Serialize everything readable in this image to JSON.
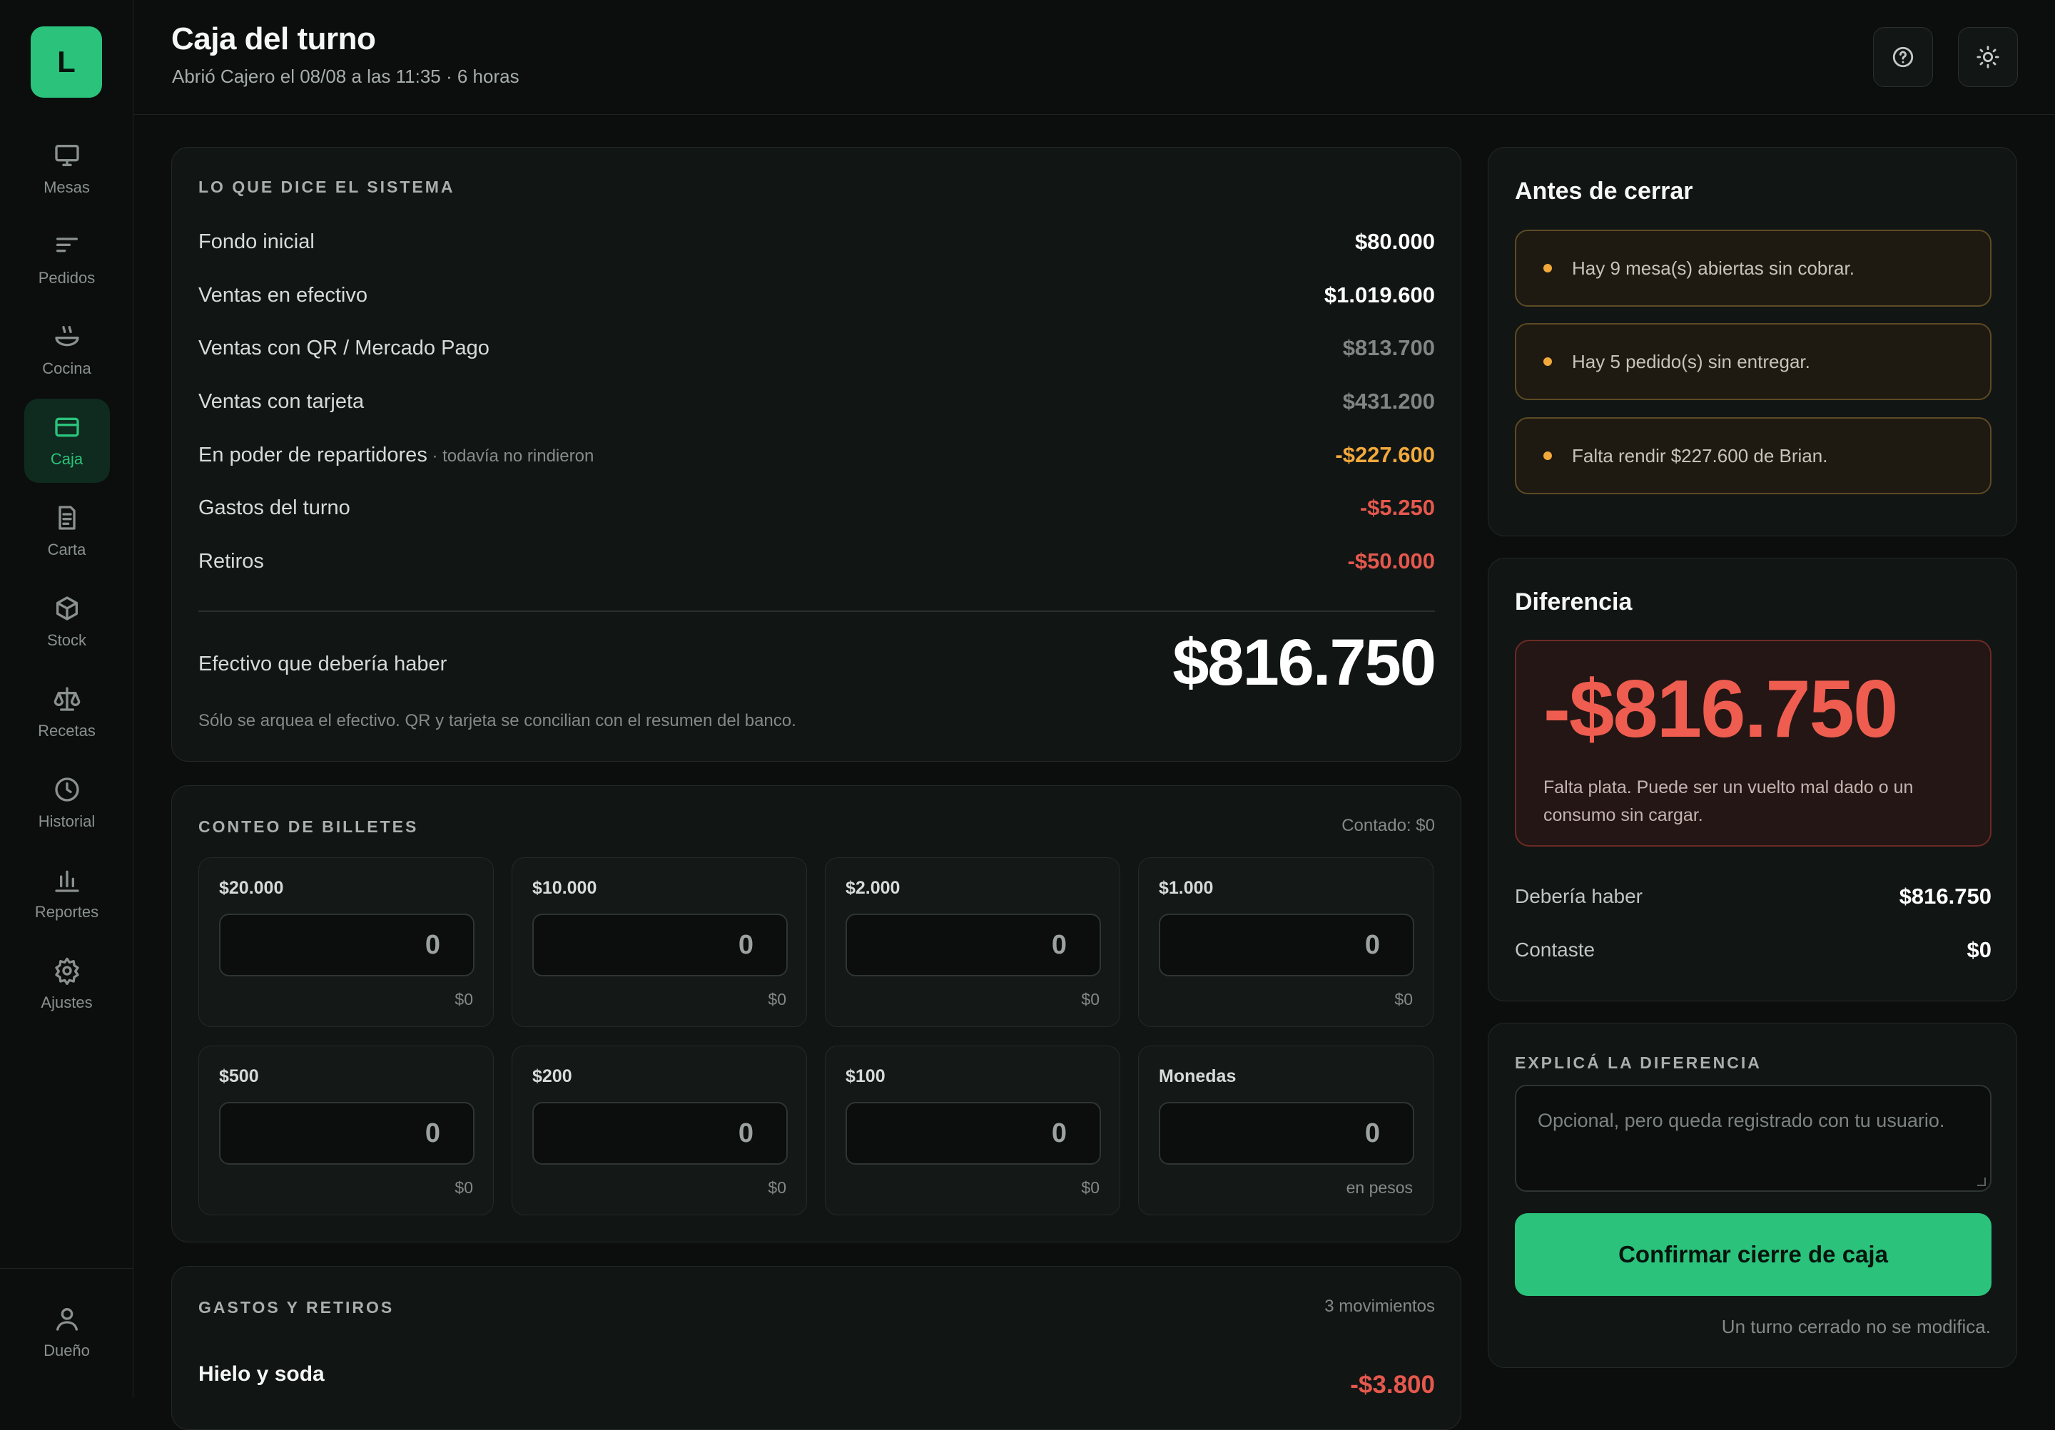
{
  "app": {
    "logo_letter": "L",
    "accent": "#2bc37c"
  },
  "sidebar": {
    "items": [
      {
        "label": "Mesas",
        "icon": "monitor-icon",
        "active": false
      },
      {
        "label": "Pedidos",
        "icon": "list-icon",
        "active": false
      },
      {
        "label": "Cocina",
        "icon": "bowl-icon",
        "active": false
      },
      {
        "label": "Caja",
        "icon": "card-icon",
        "active": true
      },
      {
        "label": "Carta",
        "icon": "document-icon",
        "active": false
      },
      {
        "label": "Stock",
        "icon": "box-icon",
        "active": false
      },
      {
        "label": "Recetas",
        "icon": "scale-icon",
        "active": false
      },
      {
        "label": "Historial",
        "icon": "clock-icon",
        "active": false
      },
      {
        "label": "Reportes",
        "icon": "bar-chart-icon",
        "active": false
      },
      {
        "label": "Ajustes",
        "icon": "gear-icon",
        "active": false
      }
    ],
    "user": {
      "label": "Dueño",
      "icon": "user-icon"
    }
  },
  "header": {
    "title": "Caja del turno",
    "subtitle": "Abrió Cajero el 08/08 a las 11:35 · 6 horas",
    "help_icon": "help-icon",
    "theme_icon": "sun-icon"
  },
  "system": {
    "section_label": "LO QUE DICE EL SISTEMA",
    "rows": [
      {
        "label": "Fondo inicial",
        "note": "",
        "value": "$80.000",
        "tone": "white"
      },
      {
        "label": "Ventas en efectivo",
        "note": "",
        "value": "$1.019.600",
        "tone": "white"
      },
      {
        "label": "Ventas con QR / Mercado Pago",
        "note": "",
        "value": "$813.700",
        "tone": "gray"
      },
      {
        "label": "Ventas con tarjeta",
        "note": "",
        "value": "$431.200",
        "tone": "gray"
      },
      {
        "label": "En poder de repartidores",
        "note": " · todavía no rindieron",
        "value": "-$227.600",
        "tone": "orange"
      },
      {
        "label": "Gastos del turno",
        "note": "",
        "value": "-$5.250",
        "tone": "red"
      },
      {
        "label": "Retiros",
        "note": "",
        "value": "-$50.000",
        "tone": "red"
      }
    ],
    "total_label": "Efectivo que debería haber",
    "total_value": "$816.750",
    "note": "Sólo se arquea el efectivo. QR y tarjeta se concilian con el resumen del banco."
  },
  "bills": {
    "section_label": "CONTEO DE BILLETES",
    "counted": "Contado: $0",
    "items": [
      {
        "label": "$20.000",
        "value": "0",
        "subtotal": "$0"
      },
      {
        "label": "$10.000",
        "value": "0",
        "subtotal": "$0"
      },
      {
        "label": "$2.000",
        "value": "0",
        "subtotal": "$0"
      },
      {
        "label": "$1.000",
        "value": "0",
        "subtotal": "$0"
      },
      {
        "label": "$500",
        "value": "0",
        "subtotal": "$0"
      },
      {
        "label": "$200",
        "value": "0",
        "subtotal": "$0"
      },
      {
        "label": "$100",
        "value": "0",
        "subtotal": "$0"
      },
      {
        "label": "Monedas",
        "value": "0",
        "subtotal": "en pesos"
      }
    ]
  },
  "moves": {
    "section_label": "GASTOS Y RETIROS",
    "count": "3 movimientos",
    "first_name": "Hielo y soda",
    "first_amount": "-$3.800"
  },
  "before_close": {
    "title": "Antes de cerrar",
    "warnings": [
      "Hay 9 mesa(s) abiertas sin cobrar.",
      "Hay 5 pedido(s) sin entregar.",
      "Falta rendir $227.600 de Brian."
    ]
  },
  "difference": {
    "title": "Diferencia",
    "value": "-$816.750",
    "note": "Falta plata. Puede ser un vuelto mal dado o un consumo sin cargar.",
    "should_label": "Debería haber",
    "should_value": "$816.750",
    "counted_label": "Contaste",
    "counted_value": "$0"
  },
  "explain": {
    "section_label": "EXPLICÁ LA DIFERENCIA",
    "placeholder": "Opcional, pero queda registrado con tu usuario.",
    "confirm_label": "Confirmar cierre de caja",
    "confirm_note": "Un turno cerrado no se modifica."
  }
}
